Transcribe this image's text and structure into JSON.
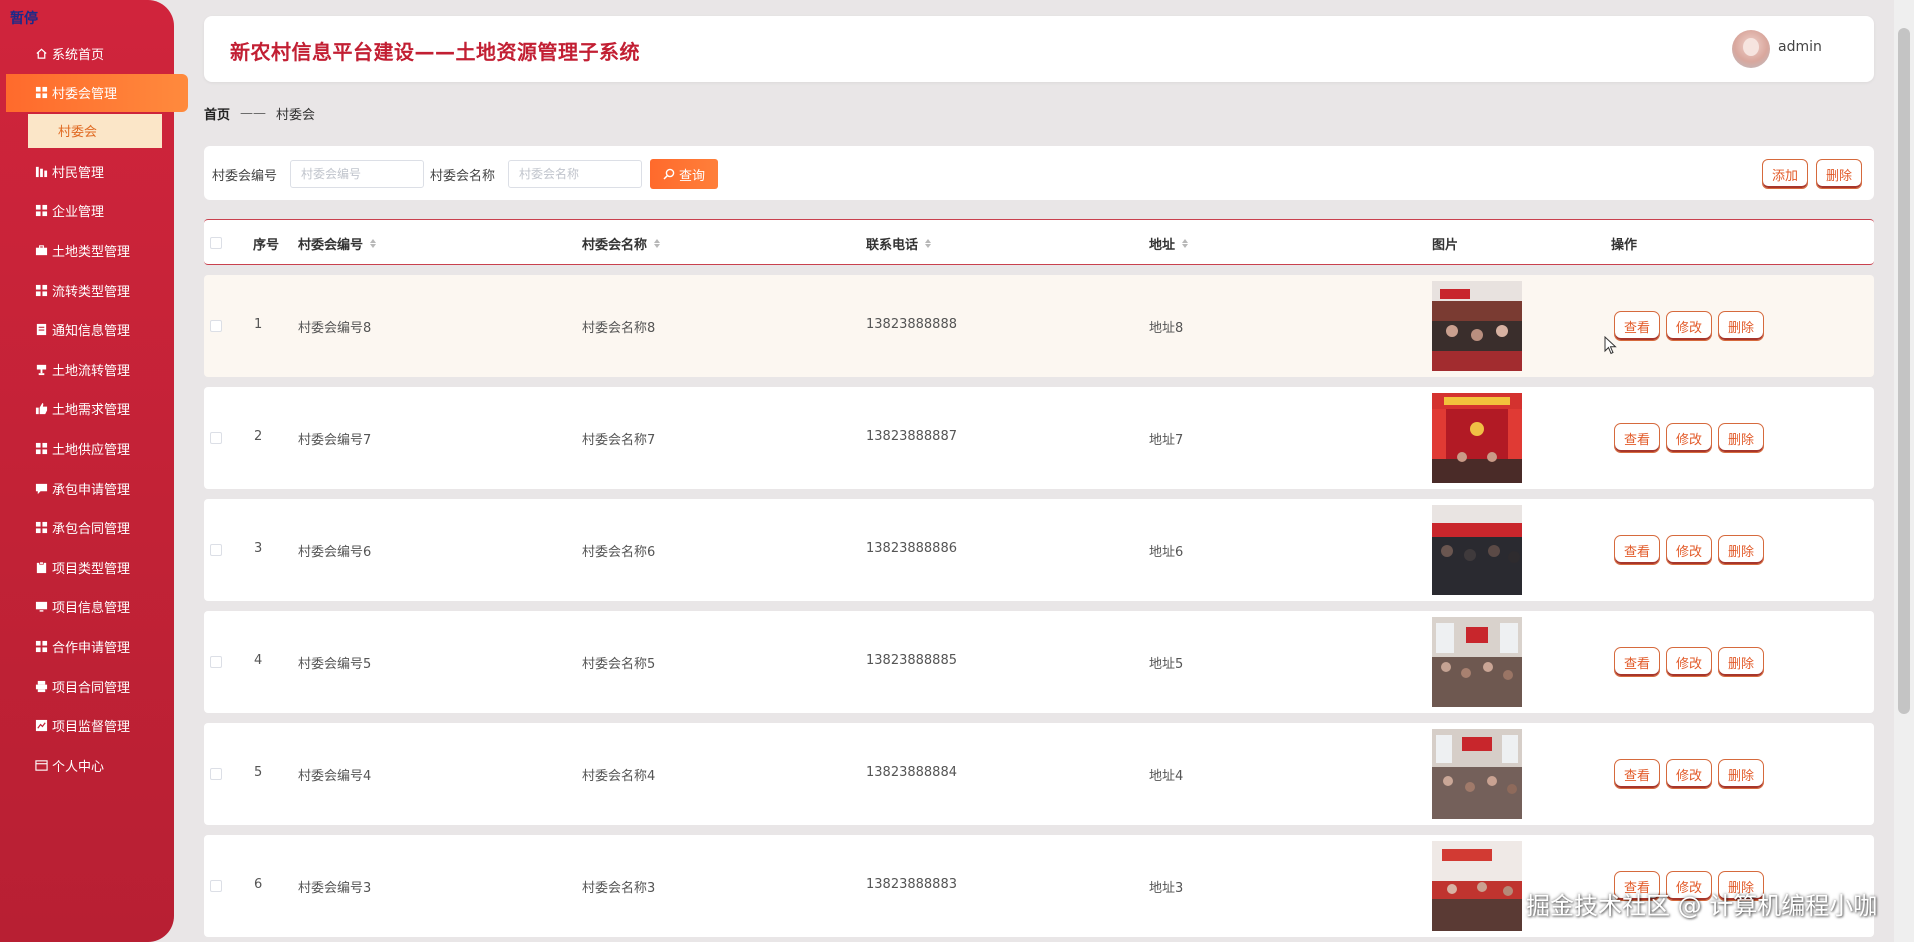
{
  "pause_label": "暂停",
  "sidebar": {
    "items": [
      {
        "label": "系统首页",
        "icon": "home-icon"
      },
      {
        "label": "村委会管理",
        "icon": "grid-icon",
        "active": true
      },
      {
        "label": "村民管理",
        "icon": "bar-chart-icon"
      },
      {
        "label": "企业管理",
        "icon": "grid-icon"
      },
      {
        "label": "土地类型管理",
        "icon": "briefcase-icon"
      },
      {
        "label": "流转类型管理",
        "icon": "grid-icon"
      },
      {
        "label": "通知信息管理",
        "icon": "document-icon"
      },
      {
        "label": "土地流转管理",
        "icon": "trophy-icon"
      },
      {
        "label": "土地需求管理",
        "icon": "thumb-icon"
      },
      {
        "label": "土地供应管理",
        "icon": "grid-icon"
      },
      {
        "label": "承包申请管理",
        "icon": "chat-icon"
      },
      {
        "label": "承包合同管理",
        "icon": "grid-icon"
      },
      {
        "label": "项目类型管理",
        "icon": "clipboard-icon"
      },
      {
        "label": "项目信息管理",
        "icon": "monitor-icon"
      },
      {
        "label": "合作申请管理",
        "icon": "grid-icon"
      },
      {
        "label": "项目合同管理",
        "icon": "printer-icon"
      },
      {
        "label": "项目监督管理",
        "icon": "line-chart-icon"
      },
      {
        "label": "个人中心",
        "icon": "user-card-icon"
      }
    ],
    "submenu_label": "村委会"
  },
  "header": {
    "title": "新农村信息平台建设——土地资源管理子系统",
    "username": "admin"
  },
  "breadcrumb": {
    "home": "首页",
    "separator": "——",
    "current": "村委会"
  },
  "search": {
    "code_label": "村委会编号",
    "code_placeholder": "村委会编号",
    "name_label": "村委会名称",
    "name_placeholder": "村委会名称",
    "search_button": "查询",
    "add_button": "添加",
    "delete_button": "删除"
  },
  "table": {
    "columns": {
      "index": "序号",
      "code": "村委会编号",
      "name": "村委会名称",
      "phone": "联系电话",
      "address": "地址",
      "image": "图片",
      "actions": "操作"
    },
    "actions": {
      "view": "查看",
      "edit": "修改",
      "delete": "删除"
    },
    "rows": [
      {
        "index": "1",
        "code": "村委会编号8",
        "name": "村委会名称8",
        "phone": "13823888888",
        "address": "地址8"
      },
      {
        "index": "2",
        "code": "村委会编号7",
        "name": "村委会名称7",
        "phone": "13823888887",
        "address": "地址7"
      },
      {
        "index": "3",
        "code": "村委会编号6",
        "name": "村委会名称6",
        "phone": "13823888886",
        "address": "地址6"
      },
      {
        "index": "4",
        "code": "村委会编号5",
        "name": "村委会名称5",
        "phone": "13823888885",
        "address": "地址5"
      },
      {
        "index": "5",
        "code": "村委会编号4",
        "name": "村委会名称4",
        "phone": "13823888884",
        "address": "地址4"
      },
      {
        "index": "6",
        "code": "村委会编号3",
        "name": "村委会名称3",
        "phone": "13823888883",
        "address": "地址3"
      }
    ]
  },
  "watermark": "掘金技术社区 @ 计算机编程小咖",
  "colors": {
    "brand_red": "#c21f33",
    "accent_orange": "#ff6a2c",
    "submenu_bg": "#fbe6c8"
  }
}
